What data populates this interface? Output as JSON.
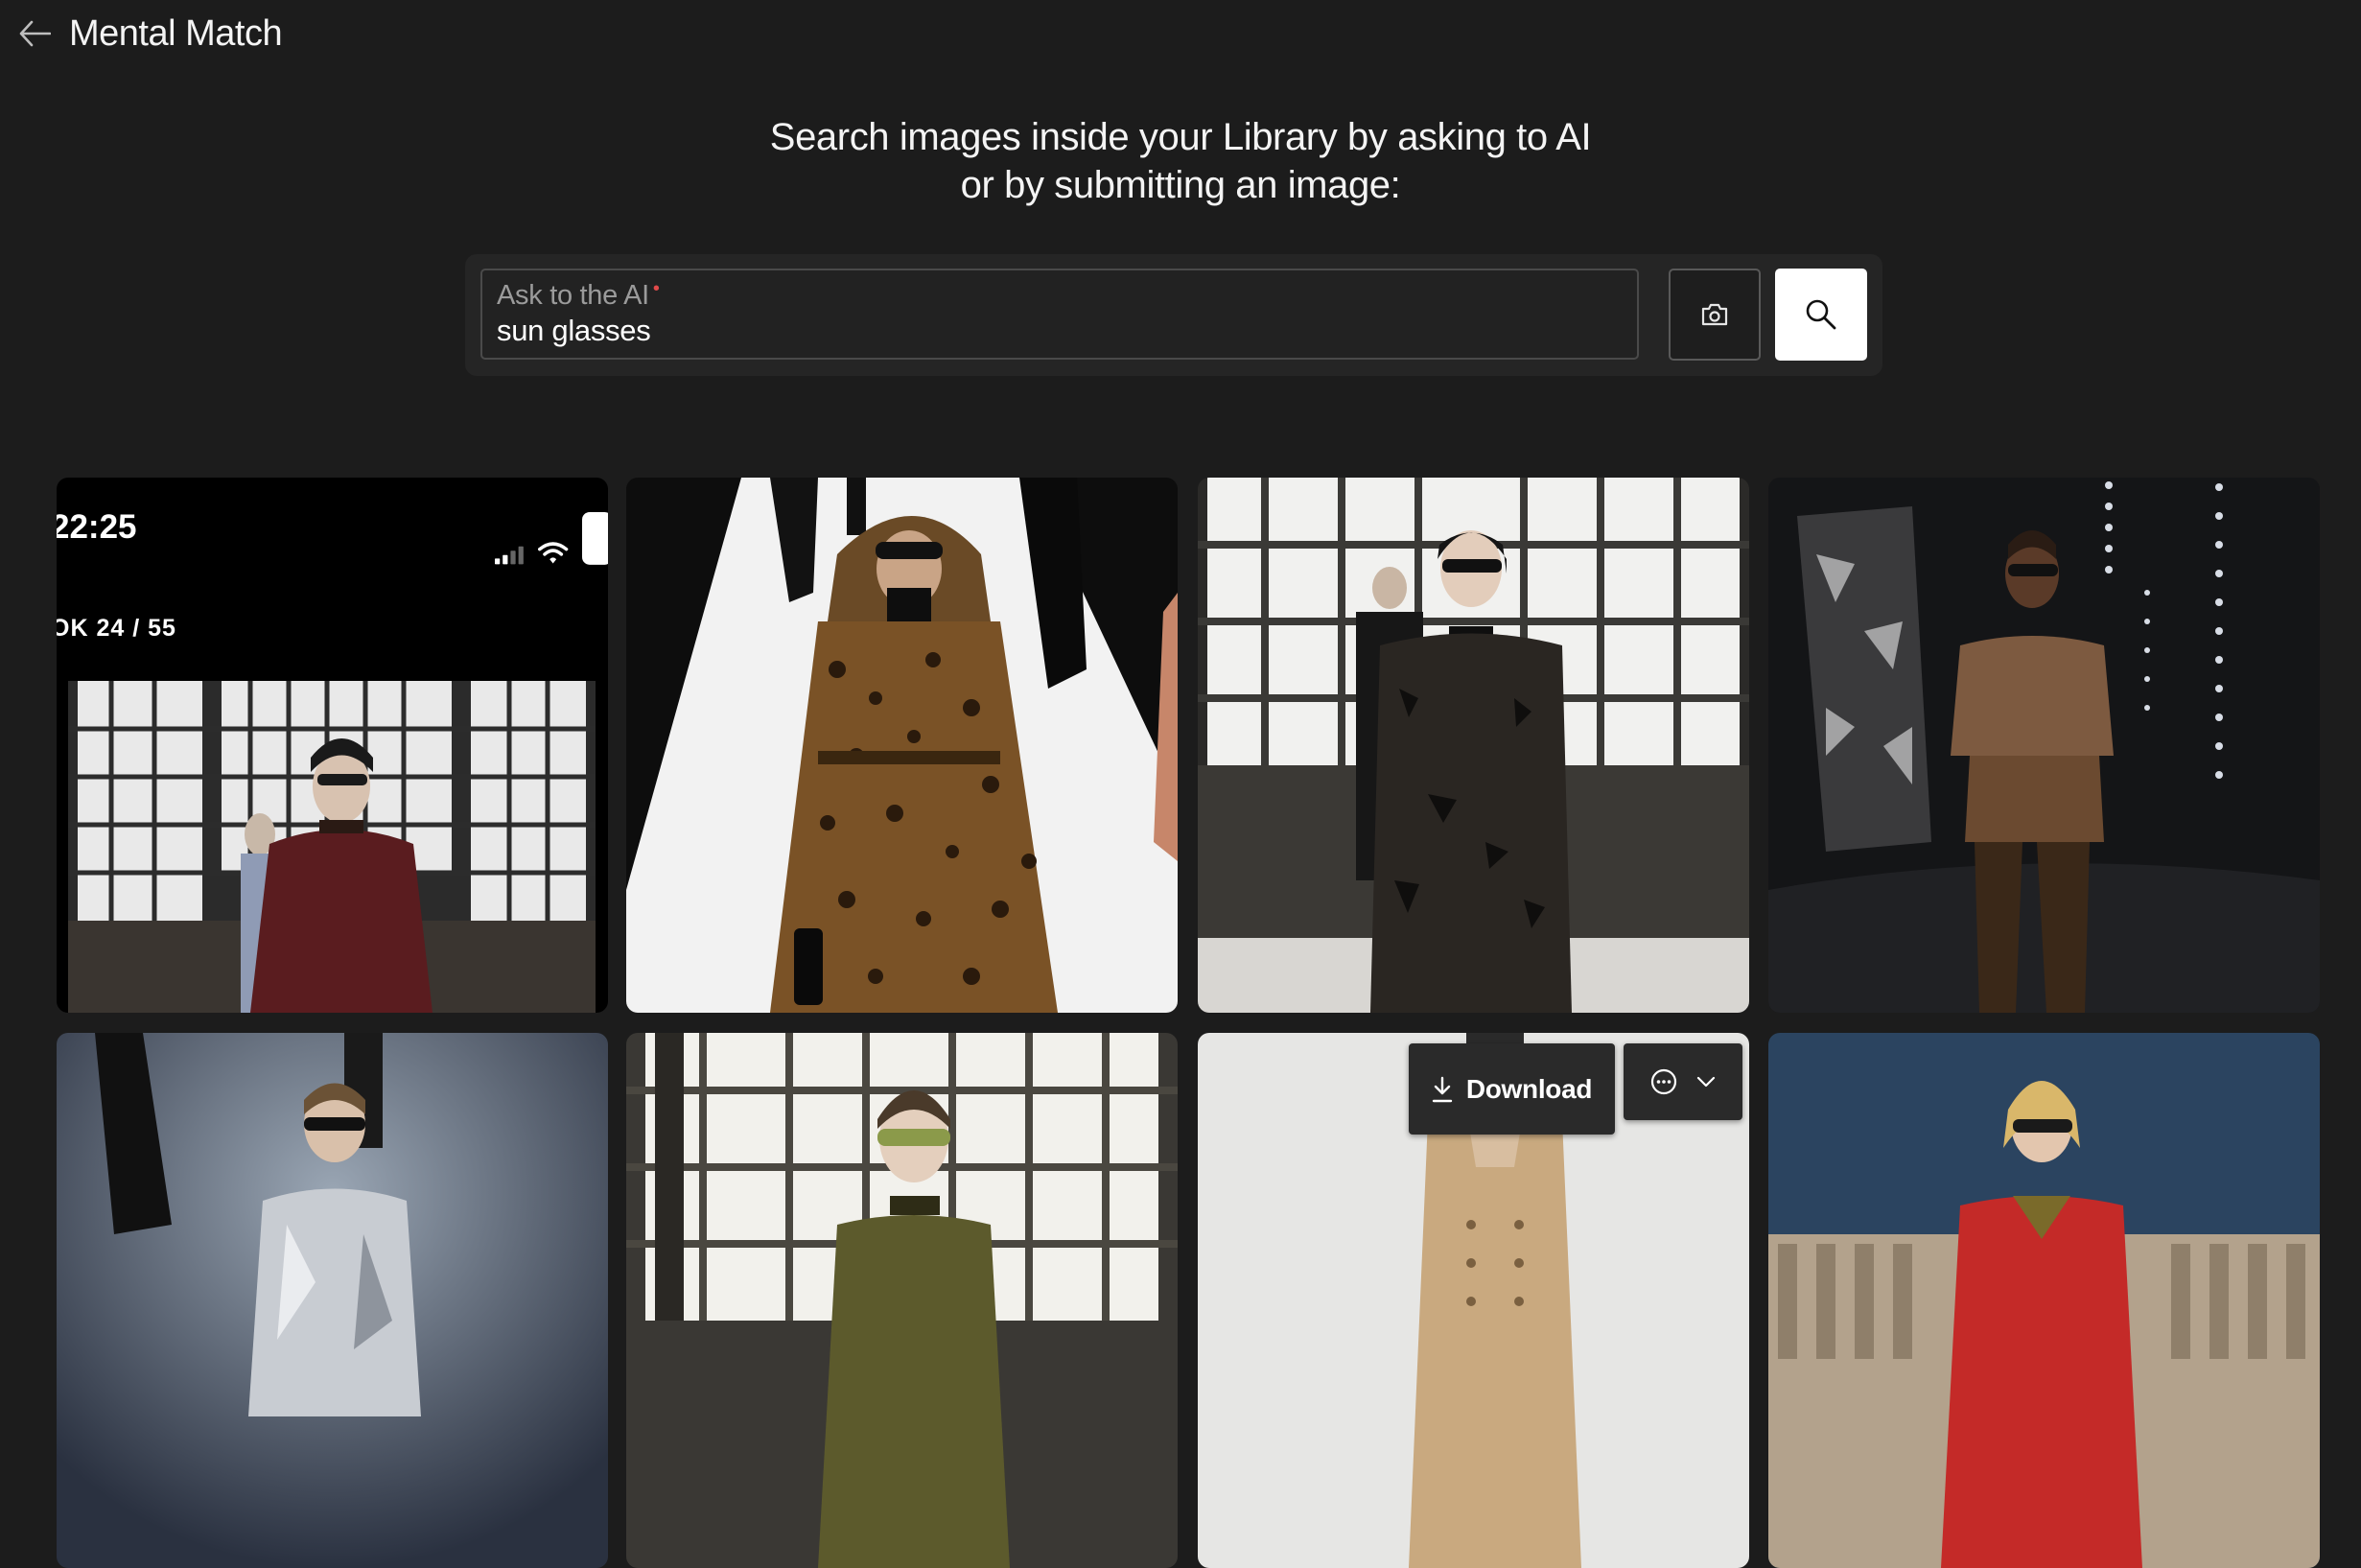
{
  "header": {
    "title": "Mental Match",
    "back_icon": "arrow-left-icon"
  },
  "intro": {
    "line1": "Search images inside your Library by asking to AI",
    "line2": "or by submitting an image:"
  },
  "search": {
    "label": "Ask to the AI",
    "required_mark": "•",
    "value": "sun glasses",
    "camera_icon": "camera-icon",
    "search_icon": "search-icon"
  },
  "results": {
    "phone_tile": {
      "time": "22:25",
      "look_counter": "OK 24 / 55"
    },
    "overlay": {
      "download_label": "Download",
      "download_icon": "download-icon",
      "more_icon": "more-options-icon",
      "chevron_icon": "chevron-down-icon"
    }
  },
  "colors": {
    "background": "#1c1c1c",
    "search_panel": "#252525",
    "required": "#e04a4a",
    "primary_button": "#ffffff"
  }
}
